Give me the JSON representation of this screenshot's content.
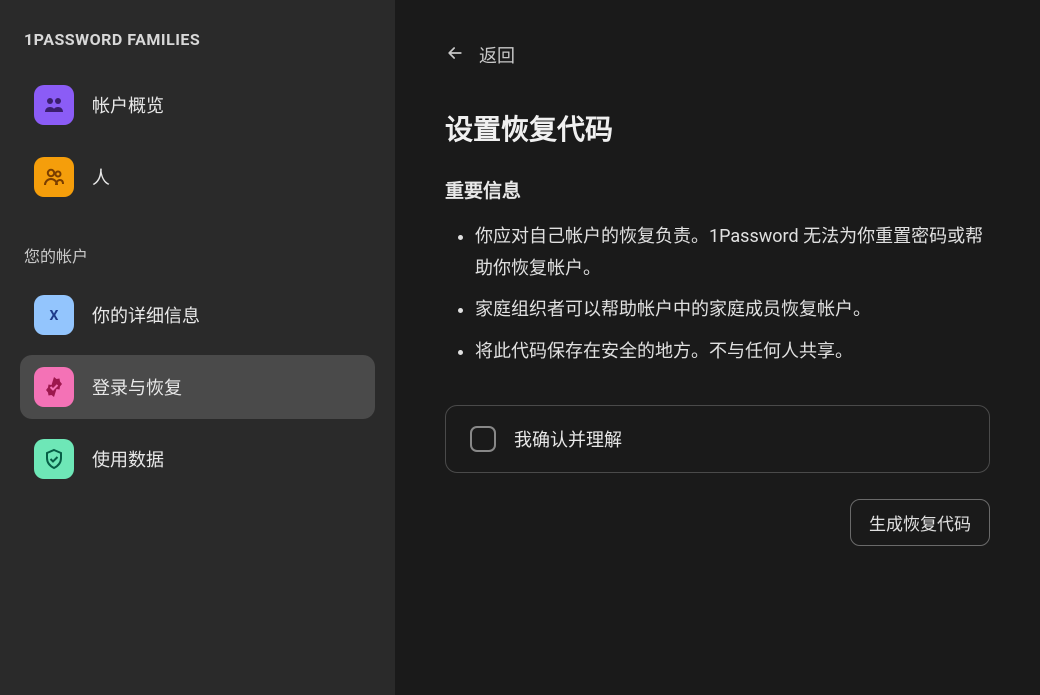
{
  "sidebar": {
    "header": "1PASSWORD FAMILIES",
    "nav": [
      {
        "label": "帐户概览"
      },
      {
        "label": "人"
      }
    ],
    "section_label": "您的帐户",
    "account_nav": [
      {
        "label": "你的详细信息"
      },
      {
        "label": "登录与恢复"
      },
      {
        "label": "使用数据"
      }
    ]
  },
  "main": {
    "back_label": "返回",
    "title": "设置恢复代码",
    "section_heading": "重要信息",
    "bullets": [
      "你应对自己帐户的恢复负责。1Password 无法为你重置密码或帮助你恢复帐户。",
      "家庭组织者可以帮助帐户中的家庭成员恢复帐户。",
      "将此代码保存在安全的地方。不与任何人共享。"
    ],
    "confirm_label": "我确认并理解",
    "generate_button": "生成恢复代码"
  }
}
